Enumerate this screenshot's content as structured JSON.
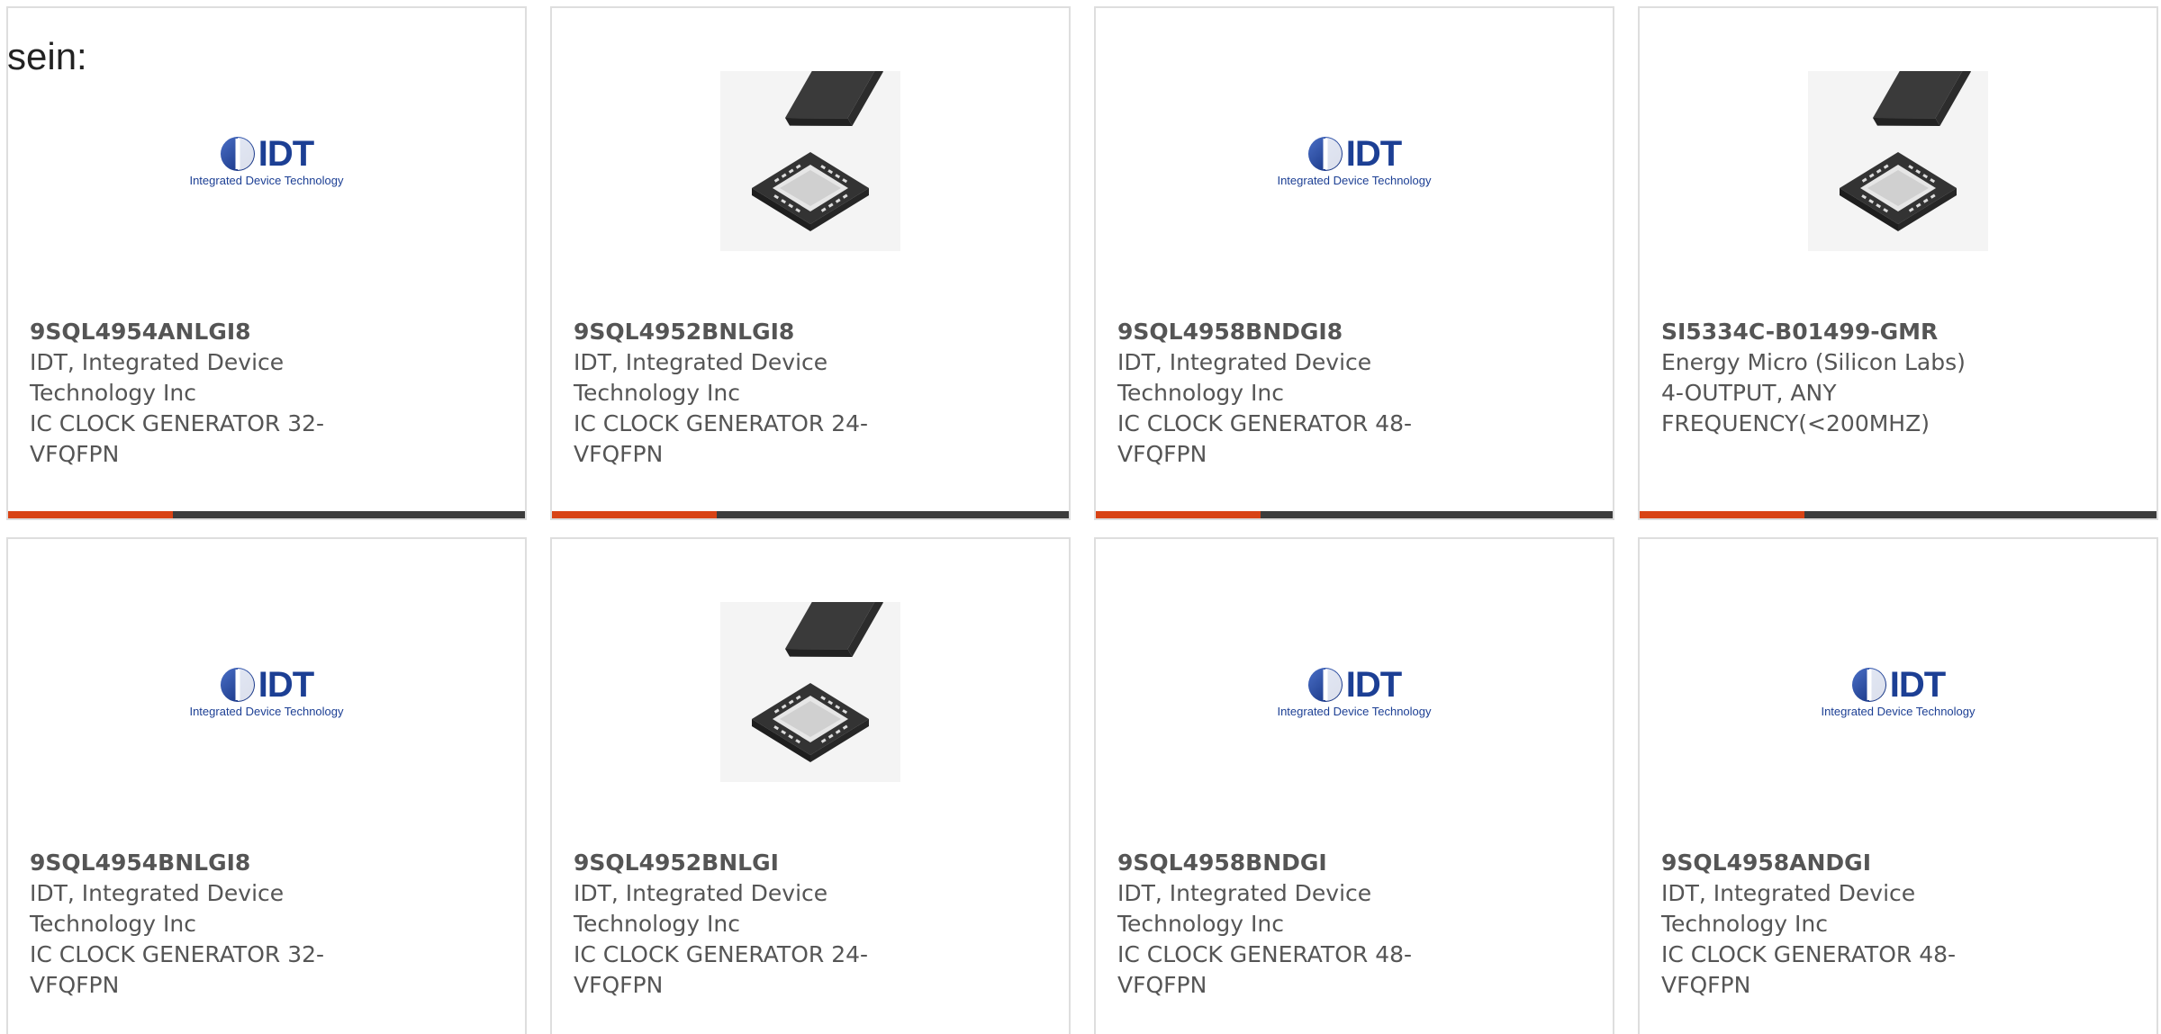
{
  "lead_text": "sein:",
  "logo": {
    "wordmark": "IDT",
    "tagline": "Integrated Device Technology"
  },
  "colors": {
    "accent_bar": "#d84315",
    "bar": "#3c3c3c",
    "card_border": "#dedede",
    "logo_blue": "#1c3f94"
  },
  "cards": [
    {
      "part_number": "9SQL4954ANLGI8",
      "manufacturer": "IDT, Integrated Device Technology Inc",
      "description": "IC CLOCK GENERATOR 32-VFQFPN",
      "image": "idt-logo"
    },
    {
      "part_number": "9SQL4952BNLGI8",
      "manufacturer": "IDT, Integrated Device Technology Inc",
      "description": "IC CLOCK GENERATOR 24-VFQFPN",
      "image": "qfn-chip"
    },
    {
      "part_number": "9SQL4958BNDGI8",
      "manufacturer": "IDT, Integrated Device Technology Inc",
      "description": "IC CLOCK GENERATOR 48-VFQFPN",
      "image": "idt-logo"
    },
    {
      "part_number": "SI5334C-B01499-GMR",
      "manufacturer": "Energy Micro (Silicon Labs)",
      "description": "4-OUTPUT, ANY FREQUENCY(<200MHZ)",
      "image": "qfn-chip"
    },
    {
      "part_number": "9SQL4954BNLGI8",
      "manufacturer": "IDT, Integrated Device Technology Inc",
      "description": "IC CLOCK GENERATOR 32-VFQFPN",
      "image": "idt-logo"
    },
    {
      "part_number": "9SQL4952BNLGI",
      "manufacturer": "IDT, Integrated Device Technology Inc",
      "description": "IC CLOCK GENERATOR 24-VFQFPN",
      "image": "qfn-chip"
    },
    {
      "part_number": "9SQL4958BNDGI",
      "manufacturer": "IDT, Integrated Device Technology Inc",
      "description": "IC CLOCK GENERATOR 48-VFQFPN",
      "image": "idt-logo"
    },
    {
      "part_number": "9SQL4958ANDGI",
      "manufacturer": "IDT, Integrated Device Technology Inc",
      "description": "IC CLOCK GENERATOR 48-VFQFPN",
      "image": "idt-logo"
    }
  ]
}
